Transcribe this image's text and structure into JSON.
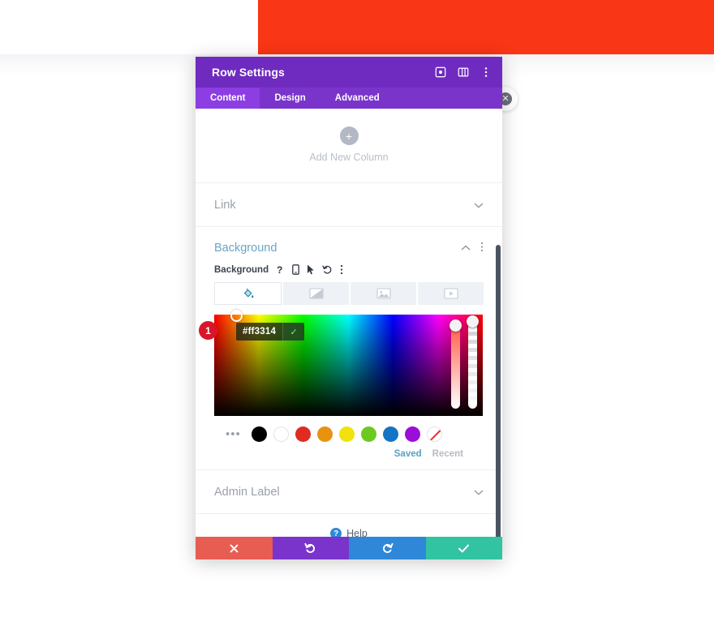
{
  "page": {
    "banner": {
      "color": "#f93615",
      "add_button_icon": "plus-icon",
      "add_button_label": "+"
    },
    "floating_close_label": "✕"
  },
  "modal": {
    "title": "Row Settings",
    "header_icons": [
      {
        "name": "fullscreen-icon"
      },
      {
        "name": "layout-columns-icon"
      },
      {
        "name": "kebab-menu-icon"
      }
    ],
    "tabs": [
      {
        "label": "Content",
        "active": true
      },
      {
        "label": "Design",
        "active": false
      },
      {
        "label": "Advanced",
        "active": false
      }
    ],
    "add_column": {
      "icon": "plus-icon",
      "icon_label": "+",
      "label": "Add New Column"
    },
    "sections": {
      "link": {
        "title": "Link",
        "chevron": "⌄"
      },
      "admin_label": {
        "title": "Admin Label",
        "chevron": "⌄"
      }
    },
    "background": {
      "title": "Background",
      "collapse_chevron": "⌃",
      "kebab": "⋮",
      "field_label": "Background",
      "field_icons": [
        {
          "name": "help-question-icon",
          "glyph": "?"
        },
        {
          "name": "responsive-device-icon"
        },
        {
          "name": "hover-cursor-icon"
        },
        {
          "name": "reset-undo-icon"
        },
        {
          "name": "kebab-menu-icon"
        }
      ],
      "types": [
        {
          "name": "background-color-tab",
          "active": true
        },
        {
          "name": "background-gradient-tab",
          "active": false
        },
        {
          "name": "background-image-tab",
          "active": false
        },
        {
          "name": "background-video-tab",
          "active": false
        }
      ],
      "color_picker": {
        "hex_value": "#ff3314",
        "confirm_glyph": "✓",
        "marker_number": "1",
        "hue_slider_name": "hue-slider",
        "alpha_slider_name": "alpha-slider"
      },
      "swatches": [
        {
          "name": "swatch-more",
          "glyph": "•••"
        },
        {
          "name": "swatch-black",
          "color": "#000000"
        },
        {
          "name": "swatch-white",
          "color": "#ffffff"
        },
        {
          "name": "swatch-red",
          "color": "#e02b20"
        },
        {
          "name": "swatch-orange",
          "color": "#e8920f"
        },
        {
          "name": "swatch-yellow",
          "color": "#f0e20c"
        },
        {
          "name": "swatch-green",
          "color": "#6cc921"
        },
        {
          "name": "swatch-blue",
          "color": "#1574c4"
        },
        {
          "name": "swatch-purple",
          "color": "#9b0ed8"
        },
        {
          "name": "swatch-transparent",
          "color": "transparent"
        }
      ],
      "palette_tabs": [
        {
          "label": "Saved",
          "active": true
        },
        {
          "label": "Recent",
          "active": false
        }
      ]
    },
    "help": {
      "icon_glyph": "?",
      "label": "Help"
    },
    "footer_buttons": [
      {
        "name": "cancel-button",
        "icon": "close-x-icon",
        "color": "#e85d52"
      },
      {
        "name": "undo-button",
        "icon": "undo-arrow-icon",
        "color": "#7a34cc"
      },
      {
        "name": "redo-button",
        "icon": "redo-arrow-icon",
        "color": "#2e87d8"
      },
      {
        "name": "save-button",
        "icon": "checkmark-icon",
        "color": "#31c3a2"
      }
    ]
  }
}
